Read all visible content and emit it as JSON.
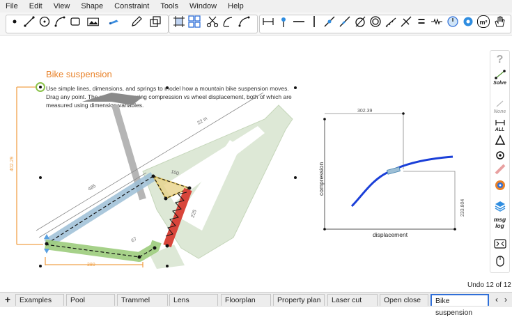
{
  "menu": [
    "File",
    "Edit",
    "View",
    "Shape",
    "Constraint",
    "Tools",
    "Window",
    "Help"
  ],
  "toolbar": {
    "tool_icons": [
      "point-tool",
      "line-tool",
      "circle-tool",
      "arc-tool",
      "rect-tool",
      "image-tool",
      "pen-tool",
      "pencil-tool",
      "text-tool",
      "resize-tool",
      "grid-tool",
      "scissors-tool",
      "tangent-tool",
      "curve-tool",
      "dimension-tool",
      "pin-tool",
      "horizontal-tool",
      "vertical-tool",
      "angle-tool",
      "parallel-tool",
      "circle-fix-tool",
      "concentric-tool",
      "ground-tool",
      "perpendicular-tool",
      "equal-tool",
      "spring-tool",
      "clock-tool",
      "gear-tool",
      "area-tool",
      "hand-tool"
    ],
    "equal_symbol": "=",
    "area_label": "m²"
  },
  "document": {
    "title": "Bike suspension",
    "description": "Use simple lines, dimensions, and springs to model how a mountain bike suspension moves. Drag any point. The pencil plots spring compression vs wheel displacement, both of which are measured using dimension variables."
  },
  "diagram": {
    "dim_22in": "22 in",
    "dim_485": "485",
    "dim_100": "100",
    "dim_67": "67",
    "dim_380": "380",
    "dim_145": "145",
    "dim_225": "225",
    "dim_vertical": "402.29"
  },
  "plot": {
    "xlabel": "displacement",
    "ylabel": "compression",
    "top_dim": "302.39",
    "right_dim": "233.804"
  },
  "sidebar": {
    "help": "?",
    "solve": "Solve",
    "none": "None",
    "all": "ALL",
    "msg": "msg",
    "log": "log"
  },
  "status": {
    "undo": "Undo 12 of 12"
  },
  "tabs": [
    "Examples",
    "Pool",
    "Trammel",
    "Lens",
    "Floorplan",
    "Property plan",
    "Laser cut",
    "Open close",
    "Bike suspension"
  ],
  "active_tab": "Bike suspension",
  "colors": {
    "accent": "#e8822a",
    "tab_active": "#2f6fd8",
    "blue_link": "#4a86b0",
    "yellow_link": "#d8b23a",
    "green_link": "#6bb23a",
    "red_spring": "#d8453a",
    "curve": "#1a3fd8"
  }
}
